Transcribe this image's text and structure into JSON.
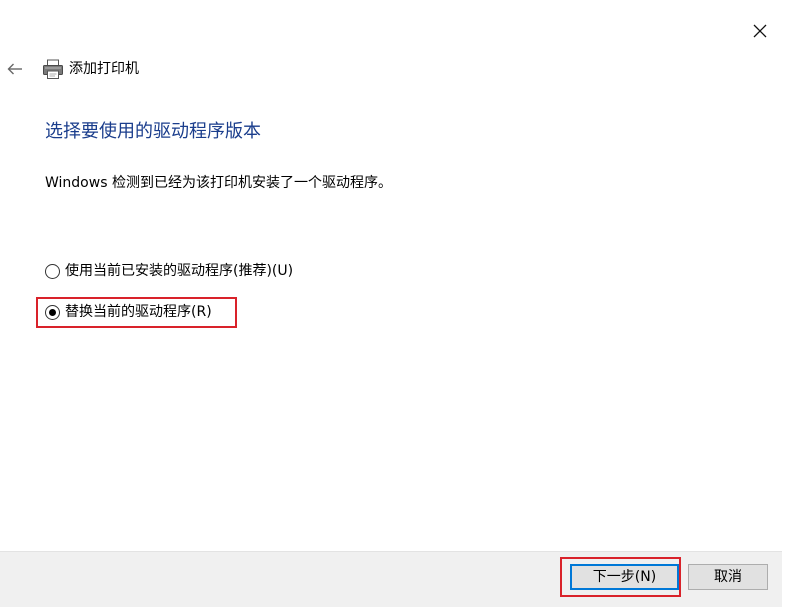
{
  "window": {
    "title": "添加打印机",
    "icons": {
      "close": "close-icon",
      "back": "back-arrow-icon",
      "app": "printer-icon"
    }
  },
  "main": {
    "heading": "选择要使用的驱动程序版本",
    "description": "Windows 检测到已经为该打印机安装了一个驱动程序。",
    "options": [
      {
        "label": "使用当前已安装的驱动程序(推荐)(U)",
        "checked": false
      },
      {
        "label": "替换当前的驱动程序(R)",
        "checked": true
      }
    ]
  },
  "footer": {
    "next_label": "下一步(N)",
    "cancel_label": "取消"
  },
  "colors": {
    "heading": "#1a3d8c",
    "highlight": "#d9222a",
    "focus_border": "#0078d7",
    "footer_bg": "#f0f0f0",
    "button_bg": "#e1e1e1"
  }
}
